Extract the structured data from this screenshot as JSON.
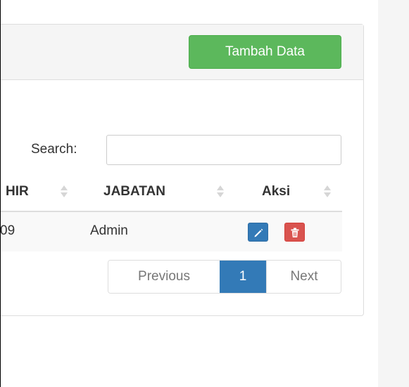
{
  "panel": {
    "add_button_label": "Tambah Data"
  },
  "search": {
    "label": "Search:",
    "value": "",
    "placeholder": ""
  },
  "table": {
    "columns": [
      "HIR",
      "JABATAN",
      "Aksi"
    ],
    "rows": [
      {
        "cells": [
          "09",
          "Admin"
        ],
        "actions": [
          "pencil-icon",
          "trash-icon"
        ]
      }
    ]
  },
  "pagination": {
    "previous": "Previous",
    "current_page": "1",
    "next": "Next"
  },
  "colors": {
    "success": "#5cb85c",
    "primary": "#337ab7",
    "danger": "#d9534f"
  }
}
